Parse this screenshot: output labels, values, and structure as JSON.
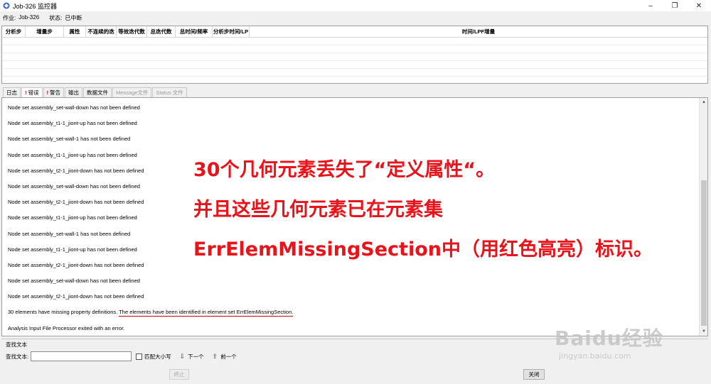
{
  "window": {
    "title": "Job-326 监控器",
    "controls": {
      "minimize": "–",
      "maximize": "❐",
      "close": "✕"
    }
  },
  "job": {
    "job_label": "作业:",
    "job_value": "Job-326",
    "status_label": "状态:",
    "status_value": "已中断"
  },
  "grid": {
    "columns": [
      "分析步",
      "增量步",
      "属性",
      "不连续的迭",
      "等效迭代数",
      "总迭代数",
      "总时间/频率",
      "分析步时间/LP",
      "时间/LPF增量"
    ]
  },
  "tabs": [
    {
      "label": "日志",
      "flag": ""
    },
    {
      "label": "错误",
      "flag": "!"
    },
    {
      "label": "警告",
      "flag": "!"
    },
    {
      "label": "输出",
      "flag": ""
    },
    {
      "label": "数据文件",
      "flag": ""
    },
    {
      "label": "Message文件",
      "flag": ""
    },
    {
      "label": "Status 文件",
      "flag": ""
    }
  ],
  "log": {
    "lines": [
      "Node set assembly_set-wall-down has not been defined",
      "Node set assembly_t1-1_jiont-up has not been defined",
      "Node set assembly_set-wall-1 has not been defined",
      "Node set assembly_t1-1_jiont-up has not been defined",
      "Node set assembly_t2-1_jiont-down has not been defined",
      "Node set assembly_set-wall-down has not been defined",
      "Node set assembly_t2-1_jiont-down has not been defined",
      "Node set assembly_t1-1_jiont-up has not been defined",
      "Node set assembly_set-wall-1 has not been defined",
      "Node set assembly_t1-1_jiont-up has not been defined",
      "Node set assembly_t2-1_jiont-down has not been defined",
      "Node set assembly_set-wall-down has not been defined",
      "Node set assembly_t2-1_jiont-down has not been defined"
    ],
    "summary_plain": "30 elements have missing property definitions. ",
    "summary_underlined": "The elements have been identified in element set ErrElemMissingSection.",
    "final_line": "Analysis Input File Processor exited with an error."
  },
  "annotation": {
    "line1": "30个几何元素丢失了“定义属性“。",
    "line2": "并且这些几何元素已在元素集",
    "line3": "ErrElemMissingSection中（用红色高亮）标识。",
    "color": "#e8141c"
  },
  "search": {
    "legend": "查找文本",
    "label": "查找文本:",
    "value": "",
    "match_case_label": "匹配大小写",
    "next_label": "下一个",
    "prev_label": "前一个"
  },
  "buttons": {
    "stop": "终止",
    "close": "关闭"
  },
  "watermark": {
    "logo": "Baidu经验",
    "url": "jingyan.baidu.com"
  }
}
